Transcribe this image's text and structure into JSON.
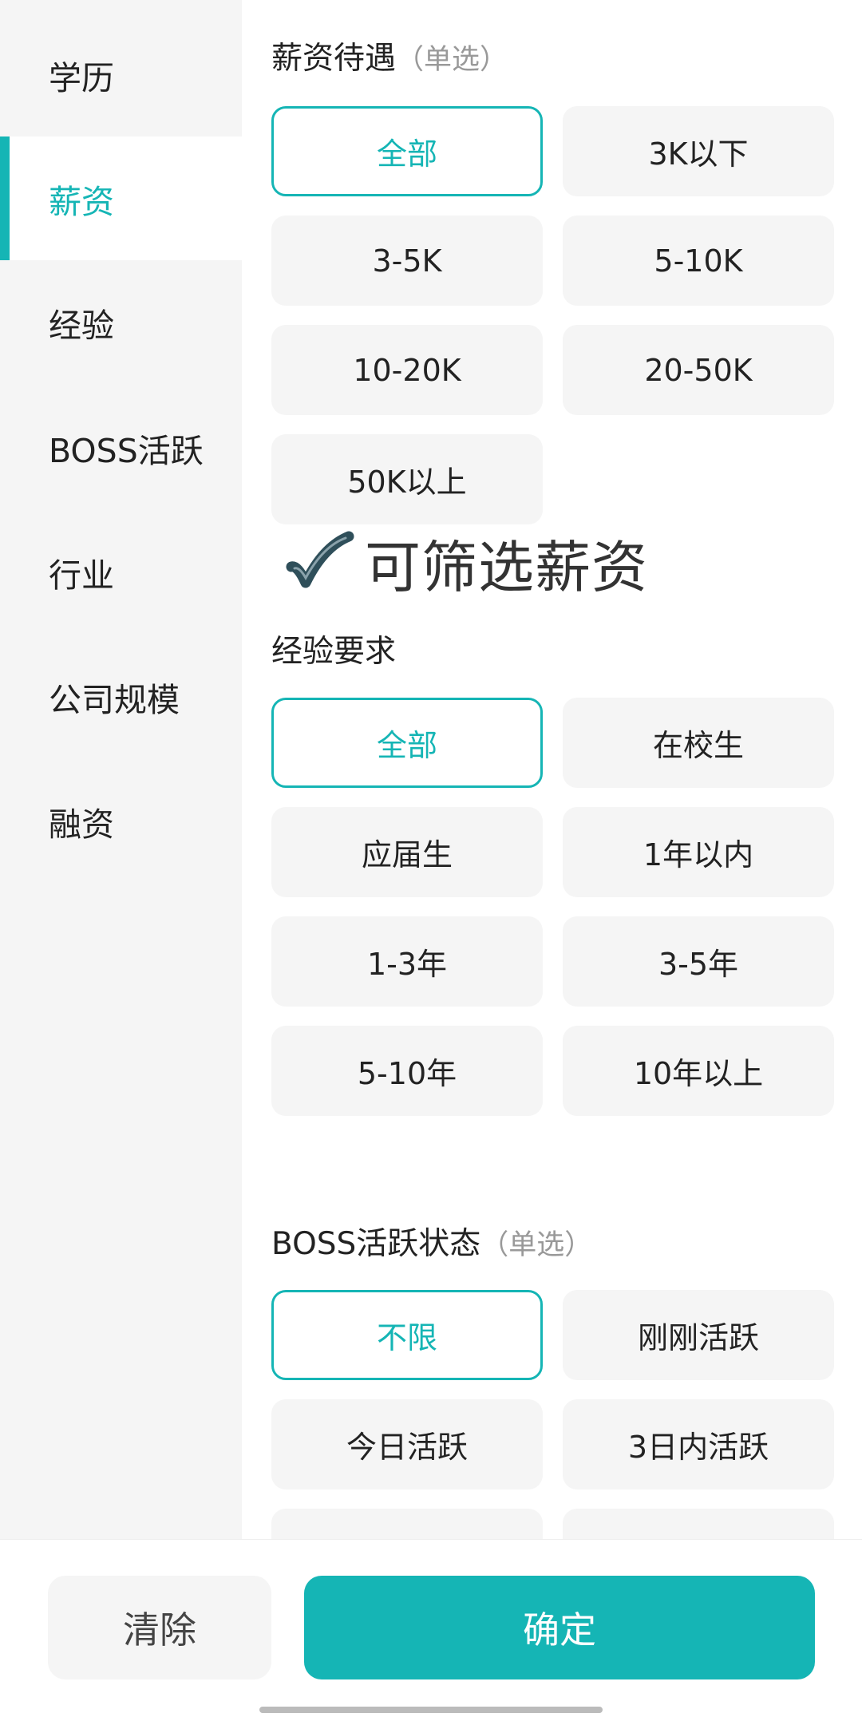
{
  "sidebar": {
    "items": [
      {
        "label": "学历",
        "active": false
      },
      {
        "label": "薪资",
        "active": true
      },
      {
        "label": "经验",
        "active": false
      },
      {
        "label": "BOSS活跃",
        "active": false
      },
      {
        "label": "行业",
        "active": false
      },
      {
        "label": "公司规模",
        "active": false
      },
      {
        "label": "融资",
        "active": false
      }
    ]
  },
  "salary": {
    "title": "薪资待遇",
    "hint": "（单选）",
    "options": [
      "全部",
      "3K以下",
      "3-5K",
      "5-10K",
      "10-20K",
      "20-50K",
      "50K以上"
    ],
    "selected": "全部"
  },
  "annotation": {
    "text": "可筛选薪资",
    "icon": "checkmark-icon"
  },
  "experience": {
    "title": "经验要求",
    "options": [
      "全部",
      "在校生",
      "应届生",
      "1年以内",
      "1-3年",
      "3-5年",
      "5-10年",
      "10年以上"
    ],
    "selected": "全部"
  },
  "boss": {
    "title": "BOSS活跃状态",
    "hint": "（单选）",
    "options": [
      "不限",
      "刚刚活跃",
      "今日活跃",
      "3日内活跃"
    ],
    "selected": "不限"
  },
  "footer": {
    "clear_label": "清除",
    "confirm_label": "确定"
  },
  "colors": {
    "accent": "#15b5b5",
    "sidebar_bg": "#f5f5f5",
    "option_bg": "#f5f5f5"
  }
}
